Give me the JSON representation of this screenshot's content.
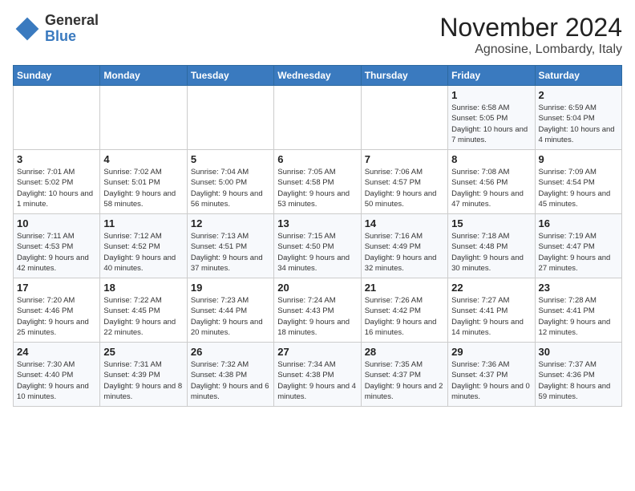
{
  "header": {
    "logo_general": "General",
    "logo_blue": "Blue",
    "month_title": "November 2024",
    "location": "Agnosine, Lombardy, Italy"
  },
  "days_of_week": [
    "Sunday",
    "Monday",
    "Tuesday",
    "Wednesday",
    "Thursday",
    "Friday",
    "Saturday"
  ],
  "weeks": [
    [
      {
        "day": "",
        "info": ""
      },
      {
        "day": "",
        "info": ""
      },
      {
        "day": "",
        "info": ""
      },
      {
        "day": "",
        "info": ""
      },
      {
        "day": "",
        "info": ""
      },
      {
        "day": "1",
        "info": "Sunrise: 6:58 AM\nSunset: 5:05 PM\nDaylight: 10 hours and 7 minutes."
      },
      {
        "day": "2",
        "info": "Sunrise: 6:59 AM\nSunset: 5:04 PM\nDaylight: 10 hours and 4 minutes."
      }
    ],
    [
      {
        "day": "3",
        "info": "Sunrise: 7:01 AM\nSunset: 5:02 PM\nDaylight: 10 hours and 1 minute."
      },
      {
        "day": "4",
        "info": "Sunrise: 7:02 AM\nSunset: 5:01 PM\nDaylight: 9 hours and 58 minutes."
      },
      {
        "day": "5",
        "info": "Sunrise: 7:04 AM\nSunset: 5:00 PM\nDaylight: 9 hours and 56 minutes."
      },
      {
        "day": "6",
        "info": "Sunrise: 7:05 AM\nSunset: 4:58 PM\nDaylight: 9 hours and 53 minutes."
      },
      {
        "day": "7",
        "info": "Sunrise: 7:06 AM\nSunset: 4:57 PM\nDaylight: 9 hours and 50 minutes."
      },
      {
        "day": "8",
        "info": "Sunrise: 7:08 AM\nSunset: 4:56 PM\nDaylight: 9 hours and 47 minutes."
      },
      {
        "day": "9",
        "info": "Sunrise: 7:09 AM\nSunset: 4:54 PM\nDaylight: 9 hours and 45 minutes."
      }
    ],
    [
      {
        "day": "10",
        "info": "Sunrise: 7:11 AM\nSunset: 4:53 PM\nDaylight: 9 hours and 42 minutes."
      },
      {
        "day": "11",
        "info": "Sunrise: 7:12 AM\nSunset: 4:52 PM\nDaylight: 9 hours and 40 minutes."
      },
      {
        "day": "12",
        "info": "Sunrise: 7:13 AM\nSunset: 4:51 PM\nDaylight: 9 hours and 37 minutes."
      },
      {
        "day": "13",
        "info": "Sunrise: 7:15 AM\nSunset: 4:50 PM\nDaylight: 9 hours and 34 minutes."
      },
      {
        "day": "14",
        "info": "Sunrise: 7:16 AM\nSunset: 4:49 PM\nDaylight: 9 hours and 32 minutes."
      },
      {
        "day": "15",
        "info": "Sunrise: 7:18 AM\nSunset: 4:48 PM\nDaylight: 9 hours and 30 minutes."
      },
      {
        "day": "16",
        "info": "Sunrise: 7:19 AM\nSunset: 4:47 PM\nDaylight: 9 hours and 27 minutes."
      }
    ],
    [
      {
        "day": "17",
        "info": "Sunrise: 7:20 AM\nSunset: 4:46 PM\nDaylight: 9 hours and 25 minutes."
      },
      {
        "day": "18",
        "info": "Sunrise: 7:22 AM\nSunset: 4:45 PM\nDaylight: 9 hours and 22 minutes."
      },
      {
        "day": "19",
        "info": "Sunrise: 7:23 AM\nSunset: 4:44 PM\nDaylight: 9 hours and 20 minutes."
      },
      {
        "day": "20",
        "info": "Sunrise: 7:24 AM\nSunset: 4:43 PM\nDaylight: 9 hours and 18 minutes."
      },
      {
        "day": "21",
        "info": "Sunrise: 7:26 AM\nSunset: 4:42 PM\nDaylight: 9 hours and 16 minutes."
      },
      {
        "day": "22",
        "info": "Sunrise: 7:27 AM\nSunset: 4:41 PM\nDaylight: 9 hours and 14 minutes."
      },
      {
        "day": "23",
        "info": "Sunrise: 7:28 AM\nSunset: 4:41 PM\nDaylight: 9 hours and 12 minutes."
      }
    ],
    [
      {
        "day": "24",
        "info": "Sunrise: 7:30 AM\nSunset: 4:40 PM\nDaylight: 9 hours and 10 minutes."
      },
      {
        "day": "25",
        "info": "Sunrise: 7:31 AM\nSunset: 4:39 PM\nDaylight: 9 hours and 8 minutes."
      },
      {
        "day": "26",
        "info": "Sunrise: 7:32 AM\nSunset: 4:38 PM\nDaylight: 9 hours and 6 minutes."
      },
      {
        "day": "27",
        "info": "Sunrise: 7:34 AM\nSunset: 4:38 PM\nDaylight: 9 hours and 4 minutes."
      },
      {
        "day": "28",
        "info": "Sunrise: 7:35 AM\nSunset: 4:37 PM\nDaylight: 9 hours and 2 minutes."
      },
      {
        "day": "29",
        "info": "Sunrise: 7:36 AM\nSunset: 4:37 PM\nDaylight: 9 hours and 0 minutes."
      },
      {
        "day": "30",
        "info": "Sunrise: 7:37 AM\nSunset: 4:36 PM\nDaylight: 8 hours and 59 minutes."
      }
    ]
  ]
}
